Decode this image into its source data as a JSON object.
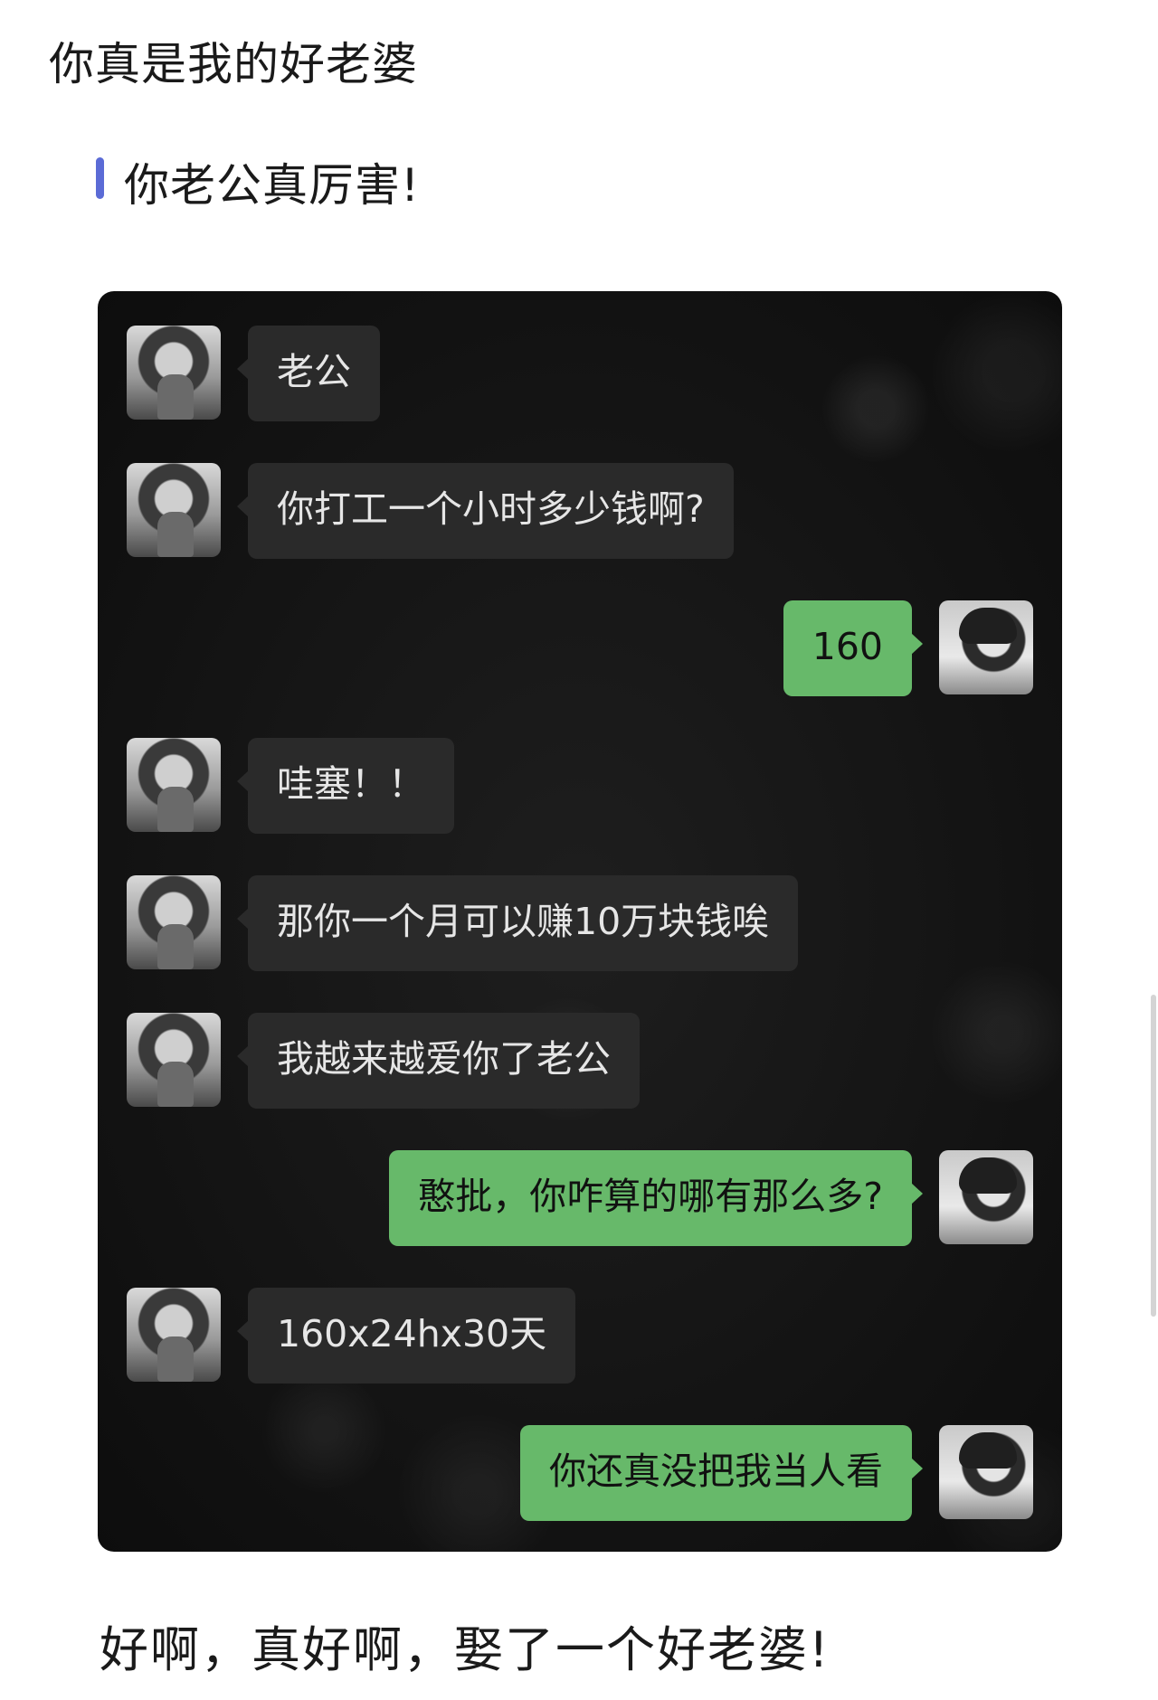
{
  "post": {
    "title": "你真是我的好老婆",
    "quote": "你老公真厉害!",
    "caption": "好啊，真好啊，娶了一个好老婆!"
  },
  "chat": {
    "messages": [
      {
        "sender": "wife",
        "text": "老公"
      },
      {
        "sender": "wife",
        "text": "你打工一个小时多少钱啊?"
      },
      {
        "sender": "husband",
        "text": "160"
      },
      {
        "sender": "wife",
        "text": "哇塞！！"
      },
      {
        "sender": "wife",
        "text": "那你一个月可以赚10万块钱唉"
      },
      {
        "sender": "wife",
        "text": "我越来越爱你了老公"
      },
      {
        "sender": "husband",
        "text": "憨批，你咋算的哪有那么多?"
      },
      {
        "sender": "wife",
        "text": "160x24hx30天"
      },
      {
        "sender": "husband",
        "text": "你还真没把我当人看"
      }
    ]
  },
  "colors": {
    "quote_bar": "#5b6bd6",
    "chat_background": "#141414",
    "incoming_bubble": "#2a2a2a",
    "outgoing_bubble": "#67b96a"
  }
}
